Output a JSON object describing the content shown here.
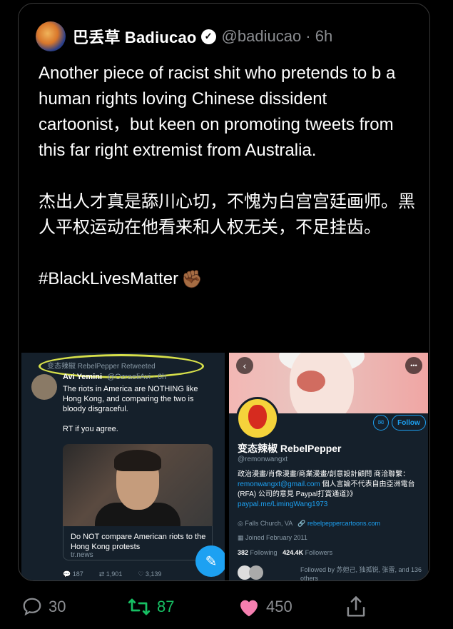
{
  "tweet": {
    "display_name": "巴丢草 Badiucao",
    "handle_time": "@badiucao · 6h",
    "text": "Another piece of racist shit who pretends to b a human rights loving Chinese dissident cartoonist，but keen on promoting tweets from this far right extremist from Australia.\n\n杰出人才真是舔川心切，不愧为白宫宫廷画师。黑人平权运动在他看来和人权无关，不足挂齿。\n\n#BlackLivesMatter",
    "emoji": "✊🏾",
    "verified_icon": "verified-badge-icon"
  },
  "left_shot": {
    "retweeted": "变态辣椒 RebelPepper Retweeted",
    "name": "Avi Yemini",
    "handle": "@OzraeliAvi · 6h",
    "text": "The riots in America are NOTHING like Hong Kong, and comparing the two is bloody disgraceful.\n\nRT if you agree.",
    "link_title": "Do NOT compare American riots to the Hong Kong protests",
    "link_url": "tr.news",
    "replies": "187",
    "retweets": "1,901",
    "likes": "3,139"
  },
  "right_shot": {
    "follow_label": "Follow",
    "name": "变态辣椒 RebelPepper",
    "handle": "@remonwangxt",
    "bio_1": "政治漫畫/肖像漫畫/商業漫畫/創意設計顧問 商洽聯繫：",
    "bio_email": "remonwangxt@gmail.com",
    "bio_2": " 個人言論不代表自由亞洲電台 (RFA) 公司的意見 Paypal打賞通道》》 ",
    "bio_paypal": "paypal.me/LimingWang1973",
    "location": "Falls Church, VA",
    "website": "rebelpeppercartoons.com",
    "joined": "Joined February 2011",
    "following_count": "382",
    "following_label": "Following",
    "followers_count": "424.4K",
    "followers_label": "Followers",
    "followed_by": "Followed by 苏妲己, 独孤锐, 张雷, and 136 others"
  },
  "actions": {
    "replies": "30",
    "retweets": "87",
    "likes": "450"
  },
  "colors": {
    "retweet": "#17bf63",
    "like": "#f57fb0",
    "link": "#1da1f2"
  }
}
